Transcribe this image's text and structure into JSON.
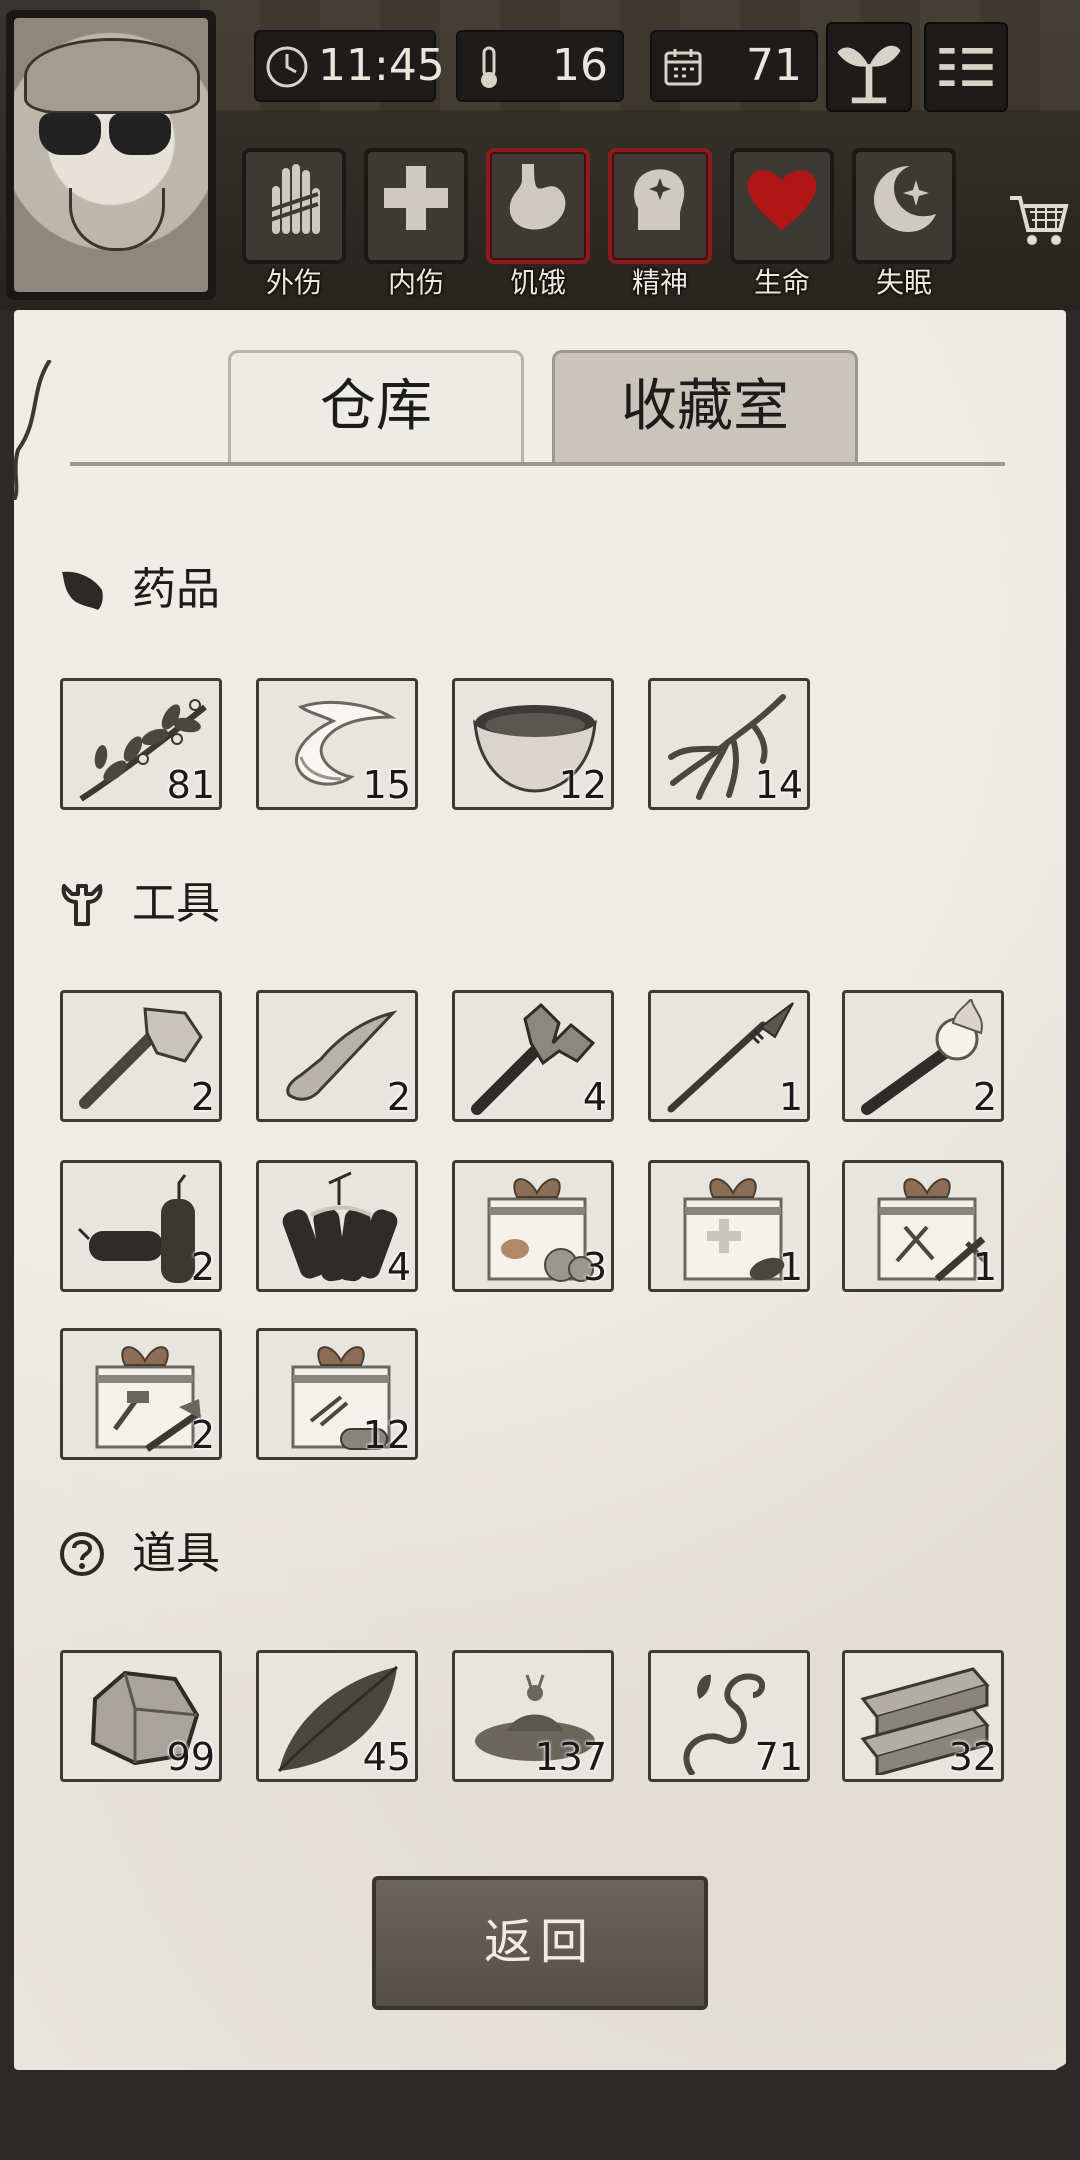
{
  "hud": {
    "time": "11:45",
    "temperature": "16",
    "days": "71"
  },
  "status_bars": [
    {
      "label": "外伤",
      "icon": "hand-bandage-icon",
      "alert": false
    },
    {
      "label": "内伤",
      "icon": "cross-icon",
      "alert": false
    },
    {
      "label": "饥饿",
      "icon": "stomach-icon",
      "alert": true
    },
    {
      "label": "精神",
      "icon": "head-sparkle-icon",
      "alert": true
    },
    {
      "label": "生命",
      "icon": "heart-icon",
      "alert": false
    },
    {
      "label": "失眠",
      "icon": "moon-star-icon",
      "alert": false
    }
  ],
  "tabs": {
    "warehouse": "仓库",
    "collection": "收藏室"
  },
  "sections": {
    "medicine": {
      "title": "药品",
      "items": [
        {
          "icon": "herb-icon",
          "count": "81"
        },
        {
          "icon": "bandage-icon",
          "count": "15"
        },
        {
          "icon": "bowl-icon",
          "count": "12"
        },
        {
          "icon": "ginseng-root-icon",
          "count": "14"
        }
      ]
    },
    "tools": {
      "title": "工具",
      "items": [
        {
          "icon": "stone-axe-icon",
          "count": "2"
        },
        {
          "icon": "stone-knife-icon",
          "count": "2"
        },
        {
          "icon": "double-axe-icon",
          "count": "4"
        },
        {
          "icon": "spear-icon",
          "count": "1"
        },
        {
          "icon": "torch-icon",
          "count": "2"
        },
        {
          "icon": "dynamite-icon",
          "count": "2"
        },
        {
          "icon": "dynamite-bundle-icon",
          "count": "4"
        },
        {
          "icon": "food-gift-box-icon",
          "count": "3"
        },
        {
          "icon": "medical-gift-box-icon",
          "count": "1"
        },
        {
          "icon": "weapon-gift-box-icon",
          "count": "1"
        },
        {
          "icon": "tool-gift-box-icon",
          "count": "2"
        },
        {
          "icon": "material-gift-box-icon",
          "count": "12"
        }
      ]
    },
    "props": {
      "title": "道具",
      "items": [
        {
          "icon": "stone-icon",
          "count": "99"
        },
        {
          "icon": "leaf-icon",
          "count": "45"
        },
        {
          "icon": "mud-splash-icon",
          "count": "137"
        },
        {
          "icon": "vine-icon",
          "count": "71"
        },
        {
          "icon": "wood-planks-icon",
          "count": "32"
        }
      ]
    }
  },
  "back_button": "返回"
}
